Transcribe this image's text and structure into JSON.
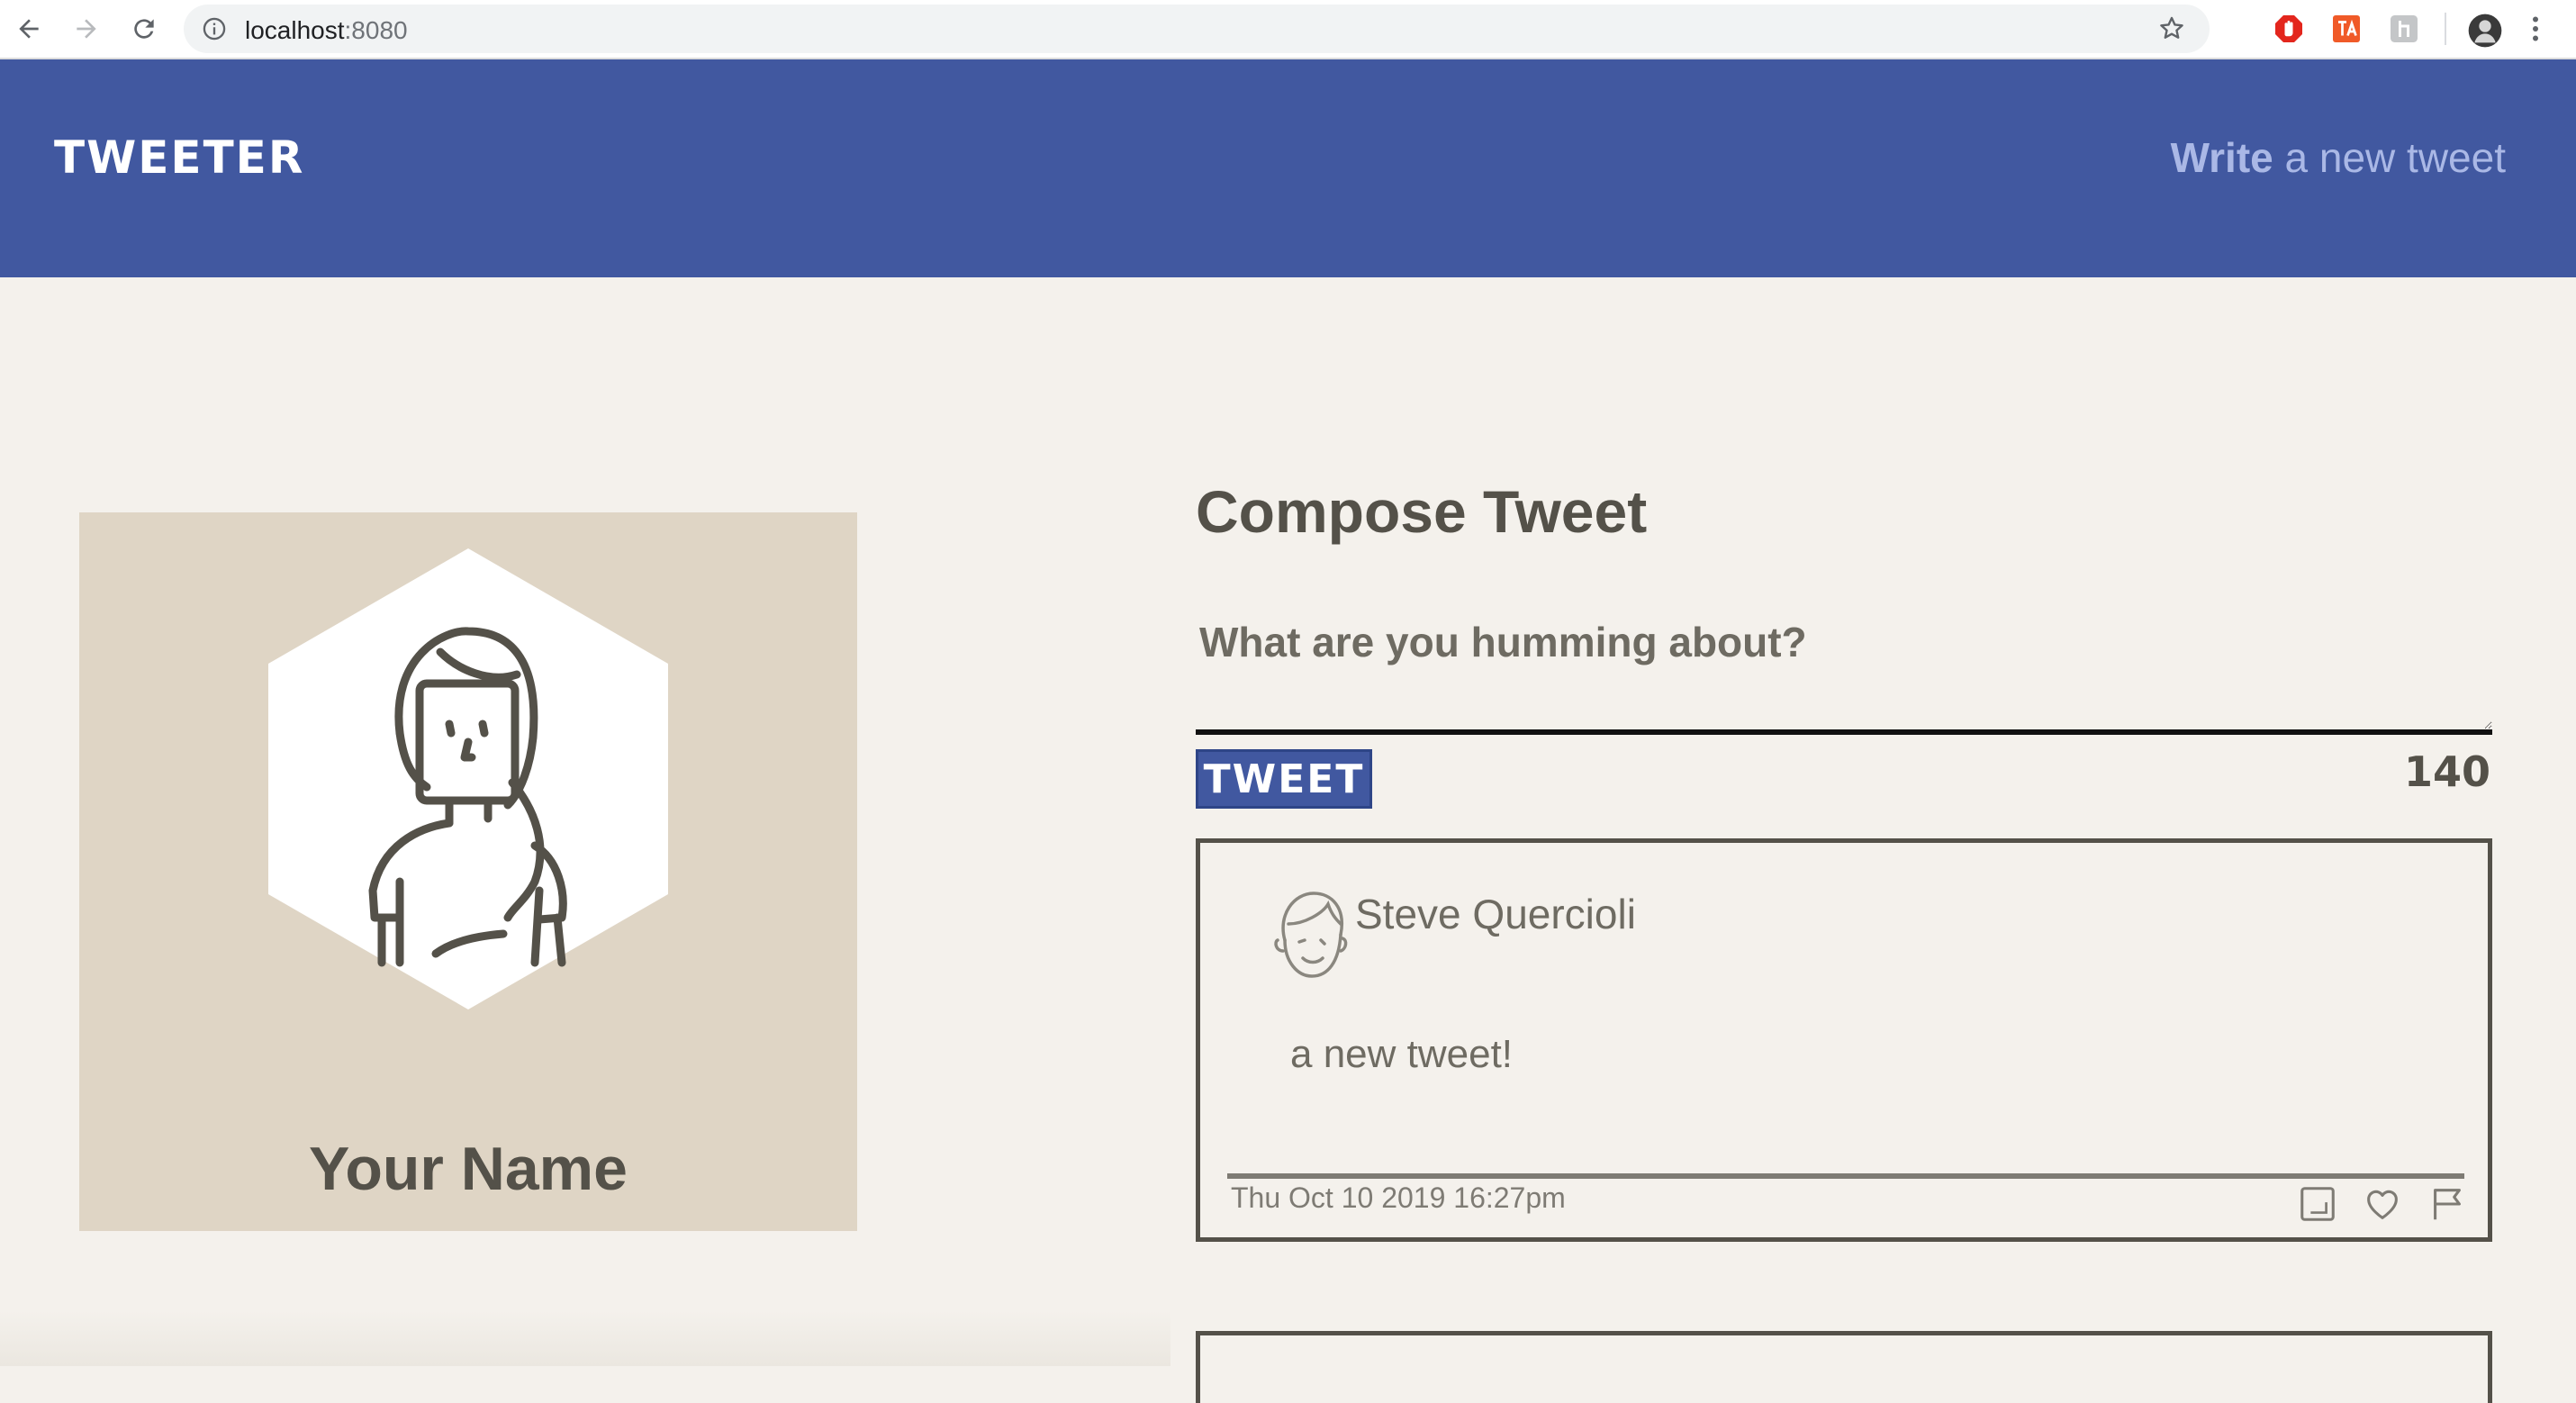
{
  "browser": {
    "url_host": "localhost",
    "url_port": ":8080"
  },
  "header": {
    "logo": "TWEETER",
    "write_strong": "Write",
    "write_rest": " a new tweet"
  },
  "profile": {
    "name": "Your Name"
  },
  "compose": {
    "title": "Compose Tweet",
    "placeholder": "What are you humming about?",
    "button_label": "TWEET",
    "counter": "140"
  },
  "tweets": [
    {
      "author": "Steve Quercioli",
      "text": "a new tweet!",
      "timestamp": "Thu Oct 10 2019 16:27pm"
    }
  ],
  "colors": {
    "header_bg": "#4158a0",
    "page_bg": "#f4f1ec",
    "text": "#545149",
    "profile_bg": "#dfd5c5"
  },
  "icons": [
    "back-icon",
    "forward-icon",
    "reload-icon",
    "info-icon",
    "star-icon",
    "retweet-icon",
    "heart-icon",
    "flag-icon"
  ]
}
